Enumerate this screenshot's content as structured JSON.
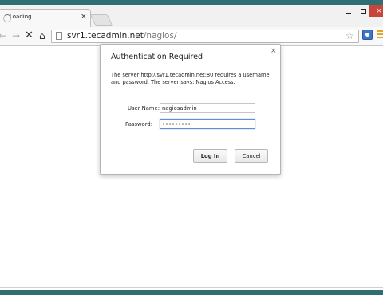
{
  "tab": {
    "title": "Loading...",
    "close": "×"
  },
  "window": {
    "close": "×"
  },
  "address": {
    "host": "svr1.tecadmin.net",
    "path": "/nagios/"
  },
  "dialog": {
    "title": "Authentication Required",
    "close": "×",
    "message": "The server http://svr1.tecadmin.net:80 requires a username and password. The server says: Nagios Access.",
    "username_label": "User Name:",
    "username_value": "nagiosadmin",
    "password_label": "Password:",
    "password_value": "•••••••••",
    "login_label": "Log In",
    "cancel_label": "Cancel"
  },
  "icons": {
    "back": "←",
    "forward": "→",
    "stop": "✕",
    "home": "⌂",
    "star": "☆",
    "menu": "hamburger-menu-icon",
    "extension": "extension-icon"
  },
  "colors": {
    "frame": "#2f6f73",
    "close_button": "#c74639",
    "focus": "#5d8fd6"
  }
}
